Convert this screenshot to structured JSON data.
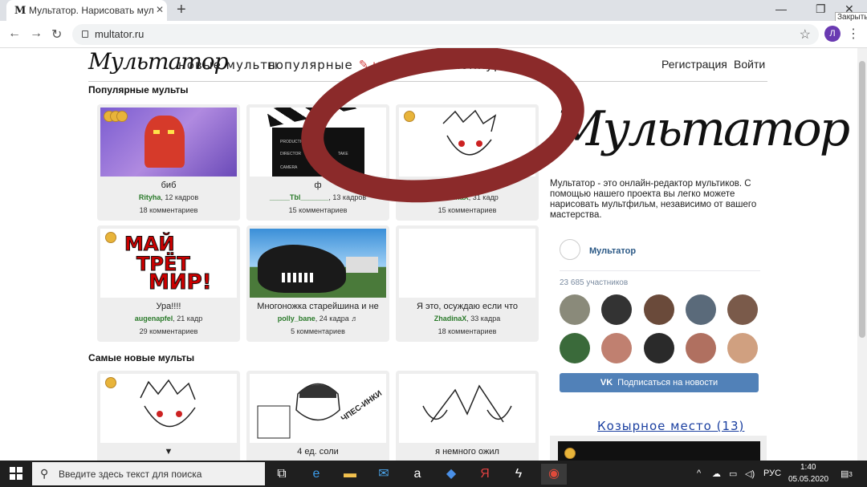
{
  "browser": {
    "tab_title": "Мультатор. Нарисовать мультфильм",
    "tab_icon": "M",
    "url": "multator.ru",
    "close_tooltip": "Закрыть",
    "profile_letter": "Л"
  },
  "site": {
    "logo": "Мультатор",
    "nav": {
      "new": "новые мульты",
      "popular": "популярные",
      "draw": "нарисовать",
      "contests": "конкурсы"
    },
    "auth": {
      "register": "Регистрация",
      "login": "Войти"
    },
    "popular_title": "Популярные мульты",
    "newest_title": "Самые новые мульты",
    "popular": [
      {
        "title": "биб",
        "author": "Rityha",
        "frames": ", 12 кадров",
        "comments": "18 комментариев"
      },
      {
        "title": "ф",
        "author": "_____Tbl_______",
        "frames": ", 13 кадров",
        "comments": "15 комментариев"
      },
      {
        "title": "▼",
        "author": "ZhadinaX",
        "frames": ", 31 кадр",
        "comments": "15 комментариев"
      },
      {
        "title": "Ура!!!!",
        "author": "augenapfel",
        "frames": ", 21 кадр",
        "comments": "29 комментариев"
      },
      {
        "title": "Многоножка старейшина и не",
        "author": "polly_bane",
        "frames": ", 24 кадра ♬",
        "comments": "5 комментариев"
      },
      {
        "title": "Я это, осуждаю если что",
        "author": "ZhadinaX",
        "frames": ", 33 кадра",
        "comments": "18 комментариев"
      }
    ],
    "newest": [
      {
        "title": "▼"
      },
      {
        "title": "4 ед. соли"
      },
      {
        "title": "я немного ожил"
      }
    ],
    "thumb_texts": {
      "clapper": [
        "PRODUCTION",
        "DIRECTOR",
        "TAKE",
        "CAMERA"
      ],
      "mir": [
        "МАЙ",
        "ТРЁТ",
        "МИР!"
      ],
      "doodle": "ЧПЕС-ИНКИ"
    },
    "big_logo": "Мультатор",
    "about": "Мультатор - это онлайн-редактор мультиков. С помощью нашего проекта вы легко можете нарисовать мультфильм, независимо от вашего мастерства.",
    "vk": {
      "name": "Мультатор",
      "members": "23 685 участников",
      "subscribe": "Подписаться на новости",
      "vk_logo": "VK"
    },
    "trump_title": "Козырное место (13)"
  },
  "taskbar": {
    "search_placeholder": "Введите здесь текст для поиска",
    "lang": "РУС",
    "time": "1:40",
    "date": "05.05.2020",
    "notifications": "3"
  },
  "colors": {
    "accent_red": "#d23c3c",
    "author_green": "#2a7a2a",
    "vk_blue": "#5181b8",
    "annotation": "#8b2a2a"
  }
}
